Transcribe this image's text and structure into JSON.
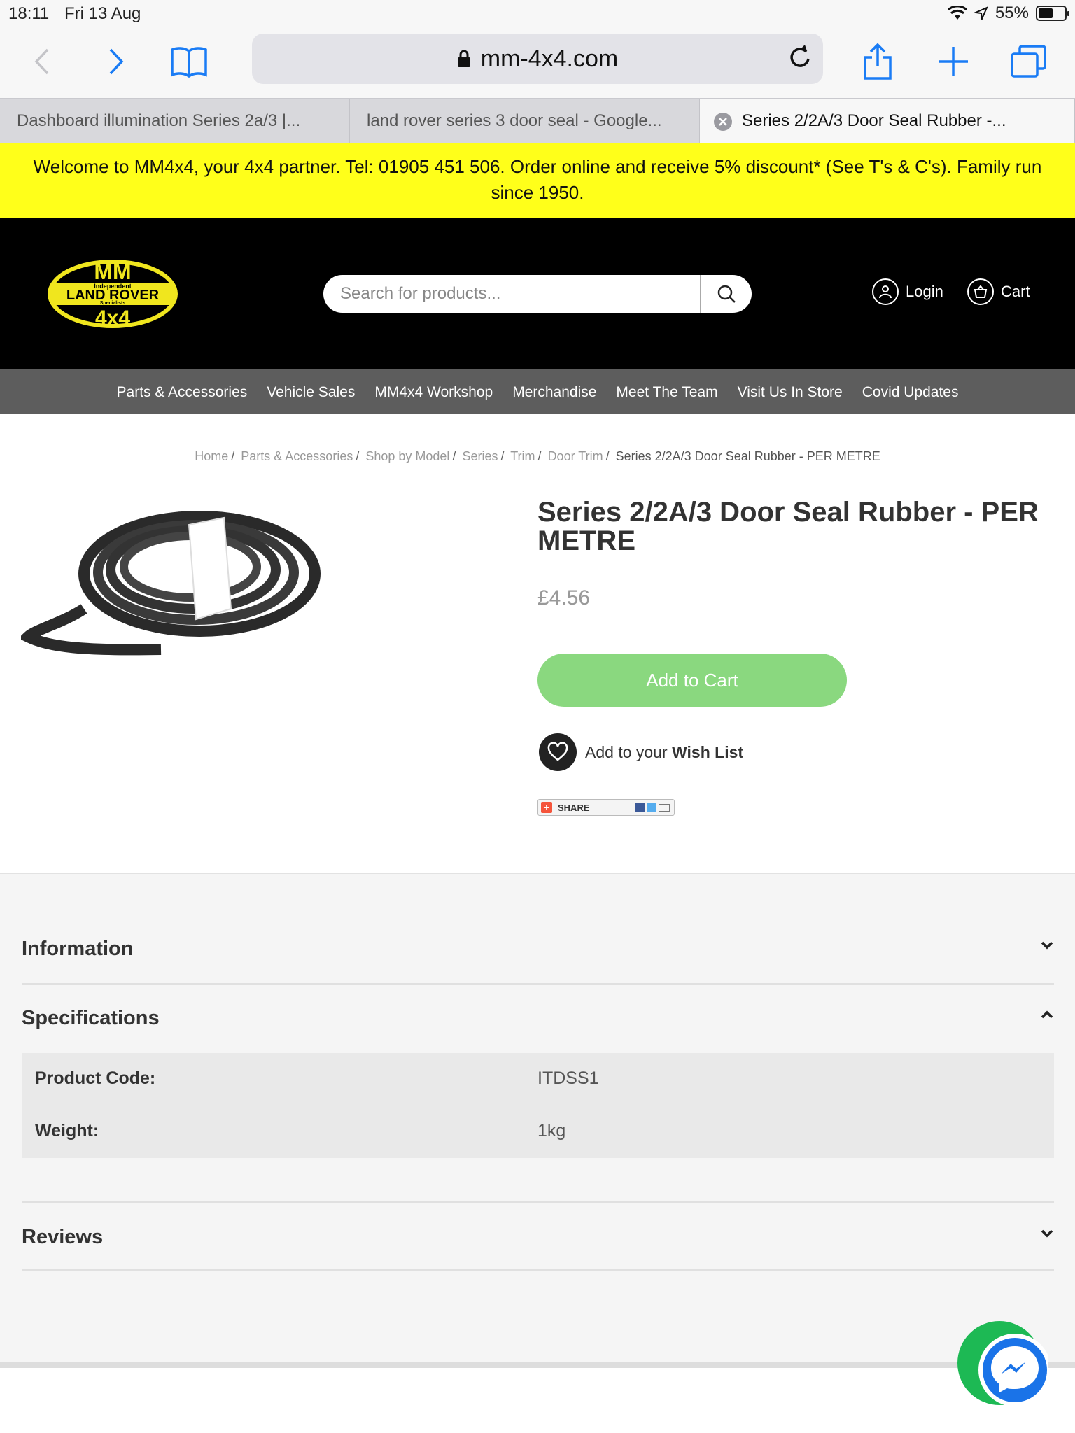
{
  "status": {
    "time": "18:11",
    "date": "Fri 13 Aug",
    "battery": "55%",
    "battery_level": 0.55
  },
  "browser": {
    "url": "mm-4x4.com",
    "tabs": [
      {
        "label": "Dashboard illumination Series 2a/3 |..."
      },
      {
        "label": "land rover series 3 door seal - Google..."
      },
      {
        "label": "Series 2/2A/3 Door Seal Rubber -..."
      }
    ]
  },
  "banner": {
    "text": "Welcome to MM4x4, your 4x4 partner. Tel: 01905 451 506. Order online and receive 5% discount* (See T's & C's). Family run since 1950."
  },
  "header": {
    "logo": {
      "top": "MM",
      "small": "Independent",
      "band": "LAND ROVER",
      "sub": "Specialists",
      "bottom": "4x4"
    },
    "search_placeholder": "Search for products...",
    "login": "Login",
    "cart": "Cart"
  },
  "nav": [
    "Parts & Accessories",
    "Vehicle Sales",
    "MM4x4 Workshop",
    "Merchandise",
    "Meet The Team",
    "Visit Us In Store",
    "Covid Updates"
  ],
  "breadcrumb": [
    "Home",
    "Parts & Accessories",
    "Shop by Model",
    "Series",
    "Trim",
    "Door Trim",
    "Series 2/2A/3 Door Seal Rubber - PER METRE"
  ],
  "product": {
    "title": "Series 2/2A/3 Door Seal Rubber - PER METRE",
    "price": "£4.56",
    "add_to_cart": "Add to Cart",
    "wish_prefix": "Add to your ",
    "wish_bold": "Wish List",
    "share": "SHARE"
  },
  "accordion": {
    "information": "Information",
    "specifications": "Specifications",
    "reviews": "Reviews"
  },
  "specs": [
    {
      "label": "Product Code:",
      "value": "ITDSS1"
    },
    {
      "label": "Weight:",
      "value": "1kg"
    }
  ],
  "colors": {
    "banner": "#ffff1a",
    "nav": "#5d5d5d",
    "add_to_cart": "#8ad87f",
    "accent_ios": "#1a7cf5"
  }
}
